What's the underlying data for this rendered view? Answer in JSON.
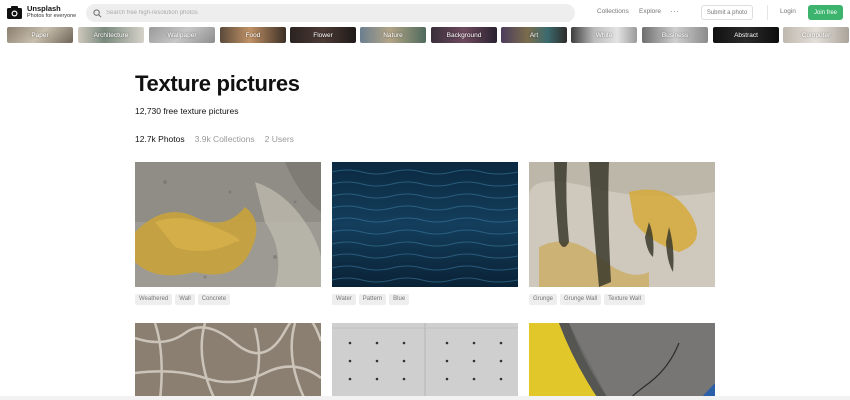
{
  "header": {
    "brand_name": "Unsplash",
    "brand_tagline": "Photos for everyone",
    "search_placeholder": "Search free high-resolution photos",
    "nav_collections": "Collections",
    "nav_explore": "Explore",
    "more_icon": "···",
    "submit_label": "Submit a photo",
    "login_label": "Login",
    "join_label": "Join free",
    "accent_color": "#3cb46e"
  },
  "topics": [
    {
      "label": "Paper"
    },
    {
      "label": "Architecture"
    },
    {
      "label": "Wallpaper"
    },
    {
      "label": "Food"
    },
    {
      "label": "Flower"
    },
    {
      "label": "Nature"
    },
    {
      "label": "Background"
    },
    {
      "label": "Art"
    },
    {
      "label": "White"
    },
    {
      "label": "Business"
    },
    {
      "label": "Abstract"
    },
    {
      "label": "Computer"
    }
  ],
  "main": {
    "title": "Texture pictures",
    "subtitle": "12,730 free texture pictures",
    "tabs": [
      {
        "label": "12.7k Photos",
        "active": true
      },
      {
        "label": "3.9k Collections",
        "active": false
      },
      {
        "label": "2 Users",
        "active": false
      }
    ]
  },
  "photos": [
    {
      "tags": [
        "Weathered",
        "Wall",
        "Concrete"
      ]
    },
    {
      "tags": [
        "Water",
        "Pattern",
        "Blue"
      ]
    },
    {
      "tags": [
        "Grunge",
        "Grunge Wall",
        "Texture Wall"
      ]
    },
    {
      "tags": []
    },
    {
      "tags": []
    },
    {
      "tags": []
    }
  ]
}
